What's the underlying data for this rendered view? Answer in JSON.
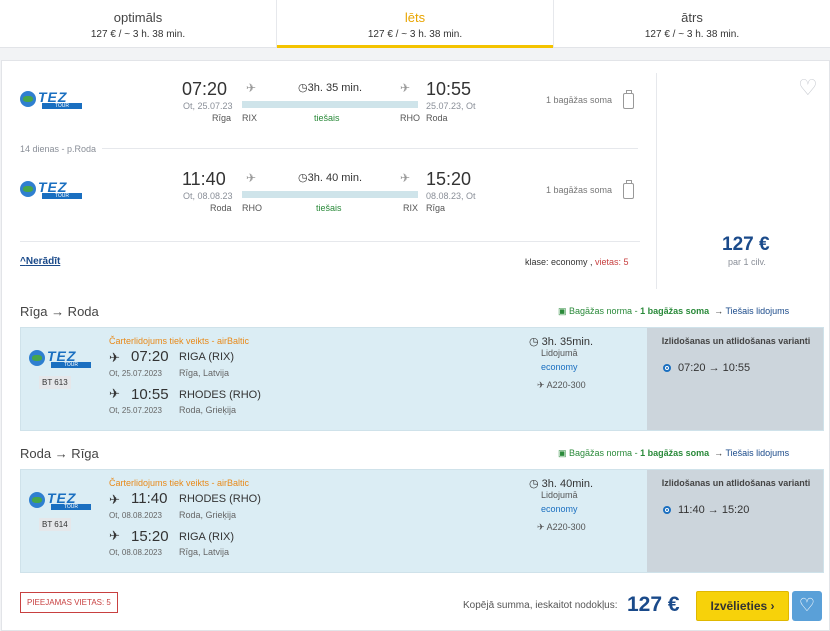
{
  "tabs": [
    {
      "name": "optimāls",
      "sub": "127 € / ~ 3 h. 38 min."
    },
    {
      "name": "lēts",
      "sub": "127 € / ~ 3 h. 38 min."
    },
    {
      "name": "ātrs",
      "sub": "127 € / ~ 3 h. 38 min."
    }
  ],
  "logo": {
    "word": "TEZ",
    "tour": "TOUR"
  },
  "outbound": {
    "dep_time": "07:20",
    "dep_date": "Ot, 25.07.23",
    "dep_city": "Rīga",
    "dep_code": "RIX",
    "duration": "3h. 35 min.",
    "direct": "tiešais",
    "arr_time": "10:55",
    "arr_date": "25.07.23, Ot",
    "arr_city": "Roda",
    "arr_code": "RHO",
    "baggage": "1 bagāžas soma"
  },
  "stay": "14 dienas - p.Roda",
  "inbound": {
    "dep_time": "11:40",
    "dep_date": "Ot, 08.08.23",
    "dep_city": "Roda",
    "dep_code": "RHO",
    "duration": "3h. 40 min.",
    "direct": "tiešais",
    "arr_time": "15:20",
    "arr_date": "08.08.23, Ot",
    "arr_city": "Rīga",
    "arr_code": "RIX",
    "baggage": "1 bagāžas soma"
  },
  "hide_label": "Nerādīt",
  "class_text": "klase: economy ,",
  "seats_text": "vietas: 5",
  "price": "127 €",
  "per_person": "par 1 cilv.",
  "sections": [
    {
      "title": "Rīga → Roda",
      "baggage_label": "Bagāžas norma - ",
      "baggage_value": "1 bagāžas soma",
      "direct_label": "Tiešais lidojums",
      "flight_no": "BT 613",
      "charter": "Čarterlidojums tiek veikts - airBaltic",
      "dep_time": "07:20",
      "dep_name": "RIGA (RIX)",
      "dep_date": "Ot, 25.07.2023",
      "dep_place": "Rīga, Latvija",
      "arr_time": "10:55",
      "arr_name": "RHODES (RHO)",
      "arr_date": "Ot, 25.07.2023",
      "arr_place": "Roda, Grieķija",
      "duration": "3h. 35min.",
      "duration_label": "Lidojumā",
      "cabin": "economy",
      "aircraft": "A220-300",
      "options_title": "Izlidošanas un atlidošanas varianti",
      "option": "07:20 → 10:55"
    },
    {
      "title": "Roda → Rīga",
      "baggage_label": "Bagāžas norma - ",
      "baggage_value": "1 bagāžas soma",
      "direct_label": "Tiešais lidojums",
      "flight_no": "BT 614",
      "charter": "Čarterlidojums tiek veikts - airBaltic",
      "dep_time": "11:40",
      "dep_name": "RHODES (RHO)",
      "dep_date": "Ot, 08.08.2023",
      "dep_place": "Roda, Grieķija",
      "arr_time": "15:20",
      "arr_name": "RIGA (RIX)",
      "arr_date": "Ot, 08.08.2023",
      "arr_place": "Rīga, Latvija",
      "duration": "3h. 40min.",
      "duration_label": "Lidojumā",
      "cabin": "economy",
      "aircraft": "A220-300",
      "options_title": "Izlidošanas un atlidošanas varianti",
      "option": "11:40 → 15:20"
    }
  ],
  "available_seats": "PIEEJAMAS VIETAS: 5",
  "total_label": "Kopējā summa, ieskaitot nodokļus:",
  "total_price": "127 €",
  "select_label": "Izvēlieties ›",
  "colors": {
    "accent": "#f4c300",
    "price": "#1a4a8a",
    "direct": "#2a8a3a",
    "charter": "#e88a1a"
  }
}
